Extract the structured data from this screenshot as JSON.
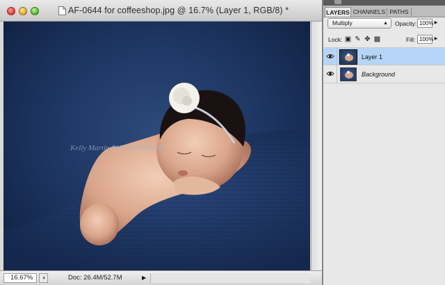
{
  "document": {
    "title": "AF-0644 for coffeeshop.jpg @ 16.7% (Layer 1, RGB/8) *",
    "watermark": "Kelly Martin PHOTOGRAPHY",
    "zoom": "16.67%",
    "doc_info": "Doc: 26.4M/52.7M"
  },
  "panel": {
    "tabs": [
      {
        "label": "LAYERS",
        "active": true
      },
      {
        "label": "CHANNELS",
        "active": false
      },
      {
        "label": "PATHS",
        "active": false
      }
    ],
    "blend_mode": "Multiply",
    "opacity_label": "Opacity:",
    "opacity_value": "100%",
    "lock_label": "Lock:",
    "fill_label": "Fill:",
    "fill_value": "100%",
    "layers": [
      {
        "name": "Layer 1",
        "selected": true,
        "visible": true
      },
      {
        "name": "Background",
        "selected": false,
        "visible": true
      }
    ]
  },
  "colors": {
    "selection": "#b6d4f6",
    "backdrop": "#1c335f"
  }
}
